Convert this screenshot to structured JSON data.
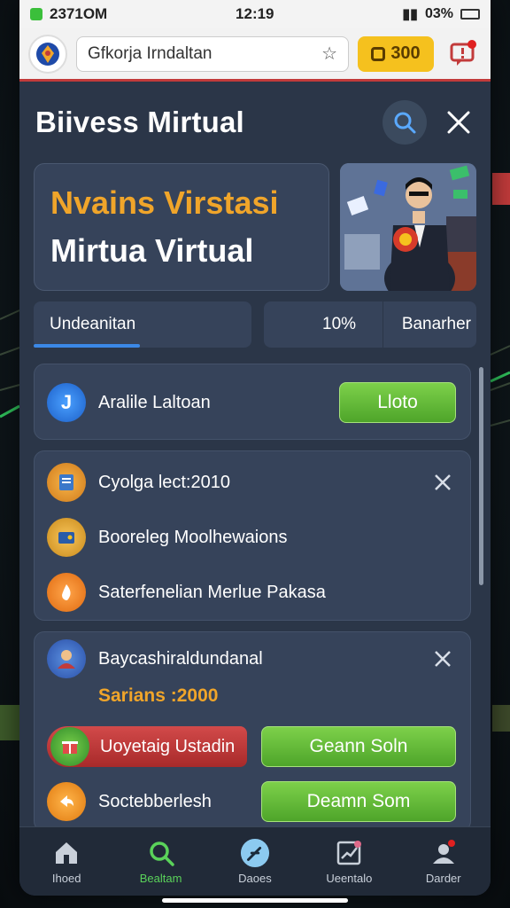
{
  "status_bar": {
    "time_left": "2371OM",
    "time_center": "12:19",
    "battery": "03%"
  },
  "app_bar": {
    "url": "Gfkorja Irndaltan",
    "coins": "300"
  },
  "header": {
    "title": "Biivess Mirtual"
  },
  "hero": {
    "line1": "Nvains Virstasi",
    "line2": "Mirtua Virtual"
  },
  "tabs": {
    "tab1_label": "Undeanitan",
    "progress_pct": "10%",
    "tab2_label": "Banarher"
  },
  "card_top": {
    "label": "Aralile Laltoan",
    "button": "Lloto"
  },
  "card_list": {
    "items": [
      {
        "label": "Cyolga lect:2010"
      },
      {
        "label": "Booreleg Moolhewaions"
      },
      {
        "label": "Saterfenelian Merlue Pakasa"
      }
    ]
  },
  "card_rewards": {
    "title": "Baycashiraldundanal",
    "subtitle": "Sarians :2000",
    "row1_label": "Uoyetaig Ustadin",
    "row1_button": "Geann Soln",
    "row2_label": "Soctebberlesh",
    "row2_button": "Deamn Som"
  },
  "bottom_nav": [
    {
      "label": "Ihoed",
      "icon": "home-icon"
    },
    {
      "label": "Bealtam",
      "icon": "search-icon"
    },
    {
      "label": "Daoes",
      "icon": "compass-icon"
    },
    {
      "label": "Ueentalo",
      "icon": "chart-icon"
    },
    {
      "label": "Darder",
      "icon": "profile-icon"
    }
  ],
  "colors": {
    "accent_orange": "#f0a52a",
    "accent_green": "#5ad25a",
    "progress_blue": "#3b88e6",
    "panel": "#36435a"
  }
}
